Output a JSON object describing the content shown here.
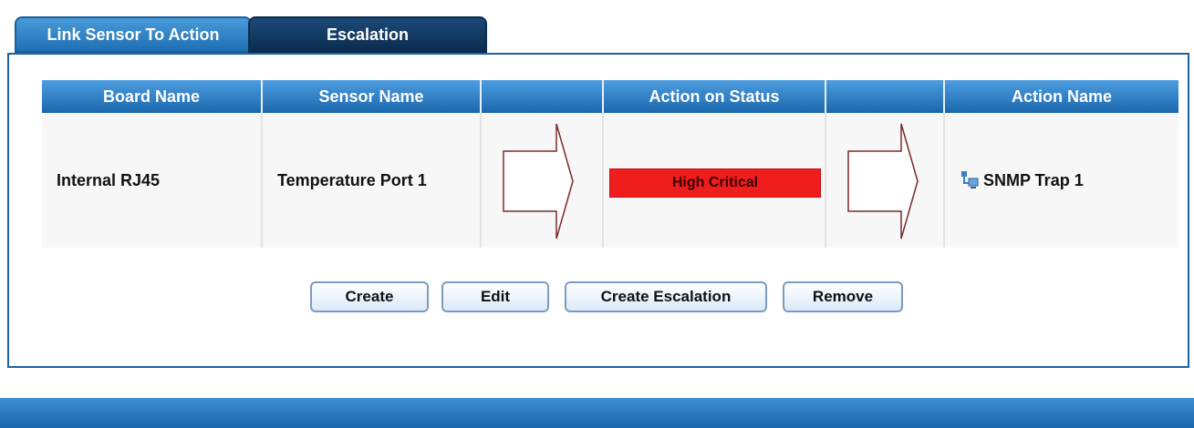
{
  "tabs": [
    {
      "label": "Link Sensor To Action",
      "active": true
    },
    {
      "label": "Escalation",
      "active": false
    }
  ],
  "table": {
    "headers": [
      "Board Name",
      "Sensor Name",
      "",
      "Action on Status",
      "",
      "Action Name"
    ],
    "row": {
      "board_name": "Internal RJ45",
      "sensor_name": "Temperature Port 1",
      "action_on_status": "High Critical",
      "action_name": "SNMP Trap 1"
    }
  },
  "buttons": {
    "create": "Create",
    "edit": "Edit",
    "create_escalation": "Create Escalation",
    "remove": "Remove"
  },
  "colors": {
    "accent": "#1f6fb3",
    "status_high_critical": "#f01d1d"
  },
  "icons": {
    "action_icon": "snmp-trap-icon",
    "flow_arrow": "arrow-right-icon"
  }
}
